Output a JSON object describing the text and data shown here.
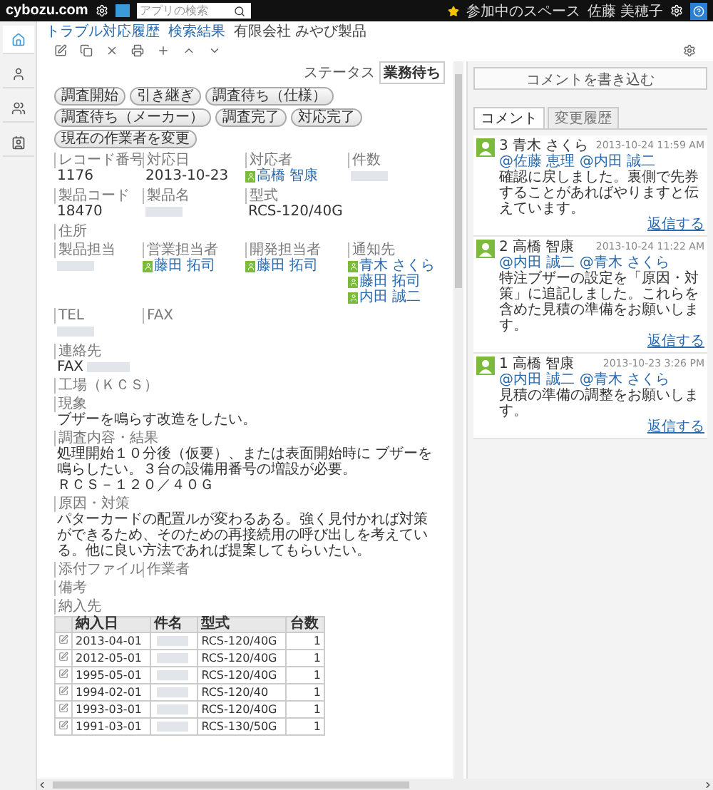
{
  "top_bar": {
    "logo": "cybozu.com",
    "search": {
      "placeholder": "アプリの検索"
    },
    "space_menu": "参加中のスペース",
    "user_menu": "佐藤 美穂子"
  },
  "side_nav": [
    {
      "kind": "home",
      "selected": true
    },
    {
      "kind": "person",
      "selected": false
    },
    {
      "kind": "people",
      "selected": false
    },
    {
      "kind": "contact",
      "selected": false
    }
  ],
  "breadcrumb": [
    "トラブル対応履歴",
    "検索結果",
    "有限会社 みやび製品"
  ],
  "status": {
    "label": "ステータス",
    "value": "業務待ち"
  },
  "actions": [
    "調査開始",
    "引き継ぎ",
    "調査待ち（仕様）",
    "調査待ち（メーカー）",
    "調査完了",
    "対応完了",
    "現在の作業者を変更"
  ],
  "rows": [
    [
      {
        "label": "レコード番号",
        "kind": "text",
        "value": "1176"
      },
      {
        "label": "対応日",
        "kind": "text",
        "value": "2013-10-23"
      },
      {
        "label": "対応者",
        "kind": "users",
        "users": [
          "高橋 智康"
        ]
      },
      {
        "label": "件数",
        "kind": "blurred"
      }
    ],
    [
      {
        "label": "製品コード",
        "kind": "text",
        "value": "18470"
      },
      {
        "label": "製品名",
        "kind": "blurred"
      },
      {
        "label": "型式",
        "kind": "text",
        "value": "RCS-120/40G"
      }
    ],
    [
      {
        "label": "住所",
        "kind": "empty"
      }
    ],
    [
      {
        "label": "製品担当",
        "kind": "blurred"
      },
      {
        "label": "営業担当者",
        "kind": "users",
        "users": [
          "藤田 拓司"
        ]
      },
      {
        "label": "開発担当者",
        "kind": "users",
        "users": [
          "藤田 拓司"
        ]
      },
      {
        "label": "通知先",
        "kind": "users",
        "users": [
          "青木 さくら",
          "藤田 拓司",
          "内田 誠二"
        ]
      }
    ],
    [
      {
        "label": "TEL",
        "kind": "blurred"
      },
      {
        "label": "FAX",
        "kind": "empty"
      }
    ],
    [
      {
        "label": "連絡先",
        "kind": "prefixed",
        "value": "FAX"
      }
    ],
    [
      {
        "label": "工場（ＫＣＳ）",
        "kind": "empty"
      }
    ],
    [
      {
        "label": "現象",
        "kind": "lines",
        "lines": [
          "ブザーを鳴らす改造をしたい。"
        ]
      }
    ],
    [
      {
        "label": "調査内容・結果",
        "kind": "lines",
        "lines": [
          "処理開始１０分後（仮要）、または表面開始時に ブザーを鳴らしたい。３台の設備用番号の増設が必要。",
          "ＲＣＳ－１２０／４０Ｇ"
        ]
      }
    ],
    [
      {
        "label": "原因・対策",
        "kind": "lines",
        "lines": [
          "パターカードの配置ルが変わるある。強く見付かれば対策ができるため、そのための再接続用の呼び出しを考えている。他に良い方法であれば提案してもらいたい。"
        ]
      }
    ],
    [
      {
        "label": "添付ファイル",
        "kind": "empty"
      },
      {
        "label": "作業者",
        "kind": "empty"
      }
    ],
    [
      {
        "label": "備考",
        "kind": "empty"
      }
    ]
  ],
  "table": {
    "label": "納入先",
    "columns": [
      "納入日",
      "件名",
      "型式",
      "台数"
    ],
    "rows": [
      {
        "date": "2013-04-01",
        "model": "RCS-120/40G",
        "count": "1"
      },
      {
        "date": "2012-05-01",
        "model": "RCS-120/40G",
        "count": "1"
      },
      {
        "date": "1995-05-01",
        "model": "RCS-120/40G",
        "count": "1"
      },
      {
        "date": "1994-02-01",
        "model": "RCS-120/40",
        "count": "1"
      },
      {
        "date": "1993-03-01",
        "model": "RCS-120/40G",
        "count": "1"
      },
      {
        "date": "1991-03-01",
        "model": "RCS-130/50G",
        "count": "1"
      }
    ]
  },
  "side_panel": {
    "write_button": "コメントを書き込む",
    "tabs": [
      {
        "label": "コメント",
        "selected": true
      },
      {
        "label": "変更履歴",
        "selected": false
      }
    ],
    "comments": [
      {
        "author": "3 青木 さくら",
        "date": "2013-10-24 11:59 AM",
        "mentions": "@佐藤 恵理 @内田 誠二",
        "text": "確認に戻しました。裏側で先券することがあればやりますと伝えています。",
        "reply": "返信する"
      },
      {
        "author": "2 高橋 智康",
        "date": "2013-10-24 11:22 AM",
        "mentions": "@内田 誠二 @青木 さくら",
        "text": "特注ブザーの設定を「原因・対策」に追記しました。これらを含めた見積の準備をお願いします。",
        "reply": "返信する"
      },
      {
        "author": "1 高橋 智康",
        "date": "2013-10-23 3:26 PM",
        "mentions": "@内田 誠二 @青木 さくら",
        "text": "見積の準備の調整をお願いします。",
        "reply": "返信する"
      }
    ]
  }
}
